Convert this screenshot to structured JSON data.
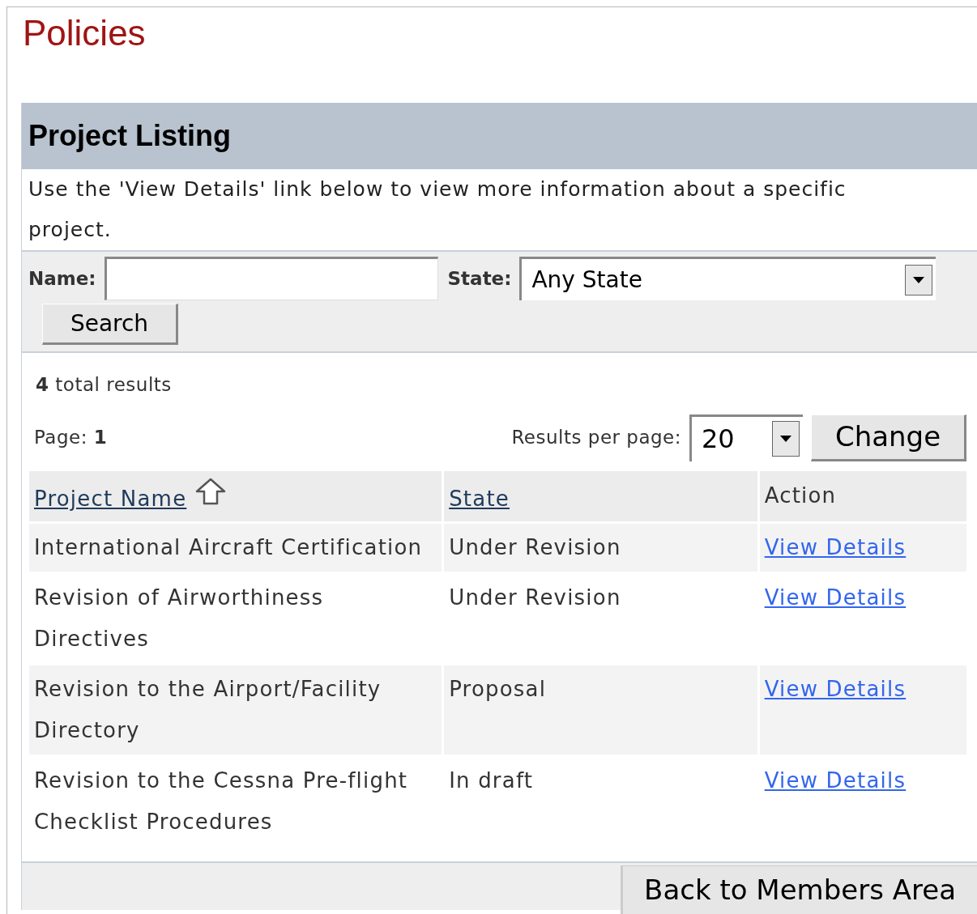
{
  "page_title": "Policies",
  "panel": {
    "title": "Project Listing",
    "description": "Use the 'View Details' link below to view more information about a specific project."
  },
  "filter": {
    "name_label": "Name:",
    "state_label": "State:",
    "state_value": "Any State",
    "search_button": "Search"
  },
  "results": {
    "total": "**4** total results",
    "page": "Page: **1**",
    "per_page_label": "Results per page:",
    "per_page_value": "20",
    "change_button": "Change"
  },
  "table": {
    "columns": [
      {
        "label": "Project Name",
        "link": true,
        "sorted": true
      },
      {
        "label": "State",
        "link": true,
        "sorted": false
      },
      {
        "label": "Action",
        "link": false,
        "sorted": false
      }
    ],
    "rows": [
      {
        "name": "International Aircraft Certification",
        "state": "Under Revision",
        "action": "View Details"
      },
      {
        "name": "Revision of Airworthiness Directives",
        "state": "Under Revision",
        "action": "View Details"
      },
      {
        "name": "Revision to the Airport/Facility Directory",
        "state": "Proposal",
        "action": "View Details"
      },
      {
        "name": "Revision to the Cessna Pre-flight Checklist Procedures",
        "state": "In draft",
        "action": "View Details"
      }
    ]
  },
  "footer": {
    "back_button": "Back to Members Area"
  }
}
